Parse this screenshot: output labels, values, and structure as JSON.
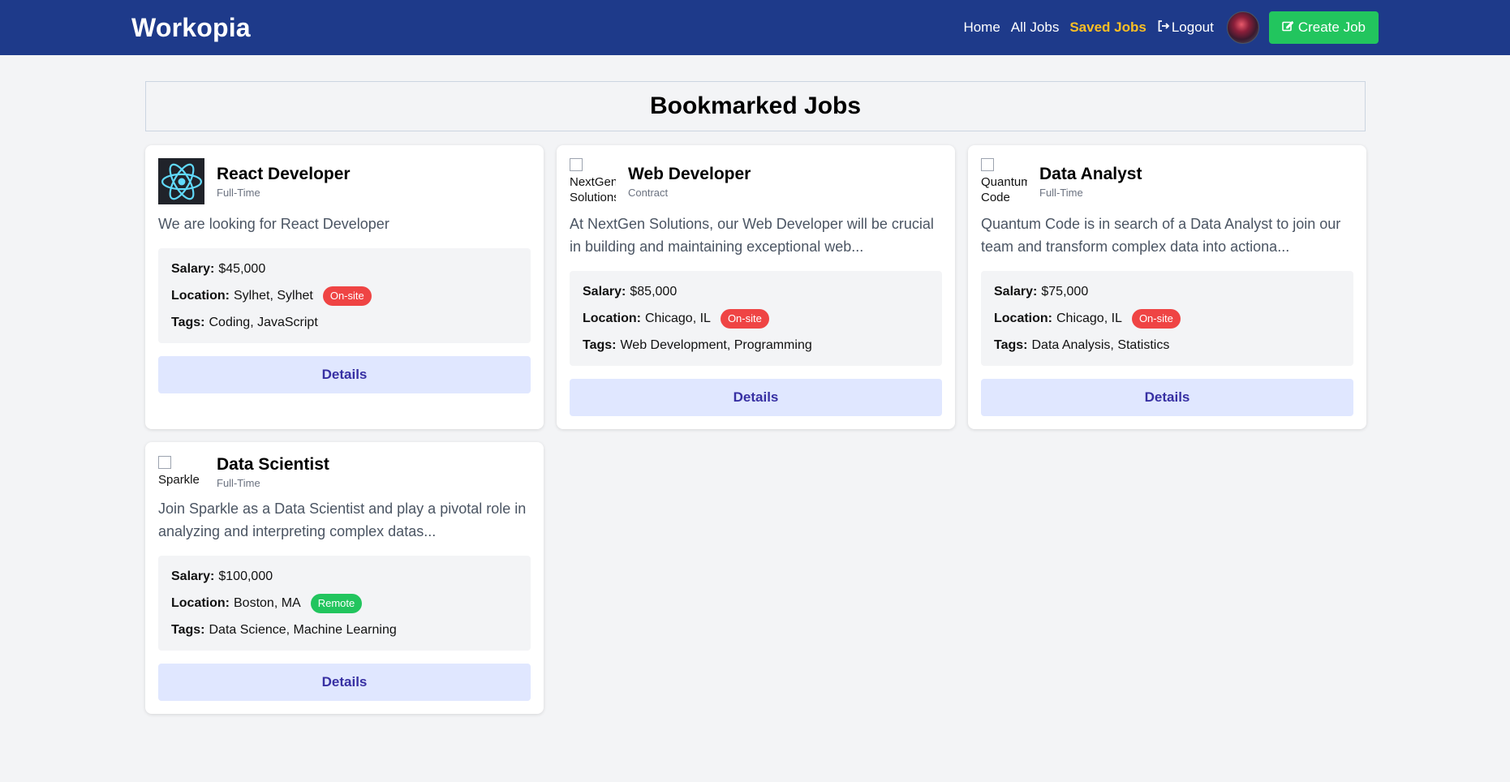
{
  "header": {
    "brand": "Workopia",
    "nav": {
      "home": "Home",
      "all_jobs": "All Jobs",
      "saved_jobs": "Saved Jobs",
      "logout": "Logout",
      "create_job": "Create Job"
    },
    "colors": {
      "bar": "#1e3a8a",
      "active": "#fbbf24",
      "create": "#22c55e"
    }
  },
  "page": {
    "title": "Bookmarked Jobs"
  },
  "labels": {
    "salary": "Salary:",
    "location": "Location:",
    "tags": "Tags:",
    "details": "Details"
  },
  "jobs": [
    {
      "logo_alt": "",
      "logo_icon": "react-logo-icon",
      "title": "React Developer",
      "type": "Full-Time",
      "description": "We are looking for React Developer",
      "salary": "$45,000",
      "location": "Sylhet, Sylhet",
      "mode": "On-site",
      "tags": "Coding, JavaScript"
    },
    {
      "logo_alt": "NextGen Solutions",
      "title": "Web Developer",
      "type": "Contract",
      "description": "At NextGen Solutions, our Web Developer will be crucial in building and maintaining exceptional web...",
      "salary": "$85,000",
      "location": "Chicago, IL",
      "mode": "On-site",
      "tags": "Web Development, Programming"
    },
    {
      "logo_alt": "Quantum Code",
      "title": "Data Analyst",
      "type": "Full-Time",
      "description": "Quantum Code is in search of a Data Analyst to join our team and transform complex data into actiona...",
      "salary": "$75,000",
      "location": "Chicago, IL",
      "mode": "On-site",
      "tags": "Data Analysis, Statistics"
    },
    {
      "logo_alt": "Sparkle",
      "title": "Data Scientist",
      "type": "Full-Time",
      "description": "Join Sparkle as a Data Scientist and play a pivotal role in analyzing and interpreting complex datas...",
      "salary": "$100,000",
      "location": "Boston, MA",
      "mode": "Remote",
      "tags": "Data Science, Machine Learning"
    }
  ]
}
